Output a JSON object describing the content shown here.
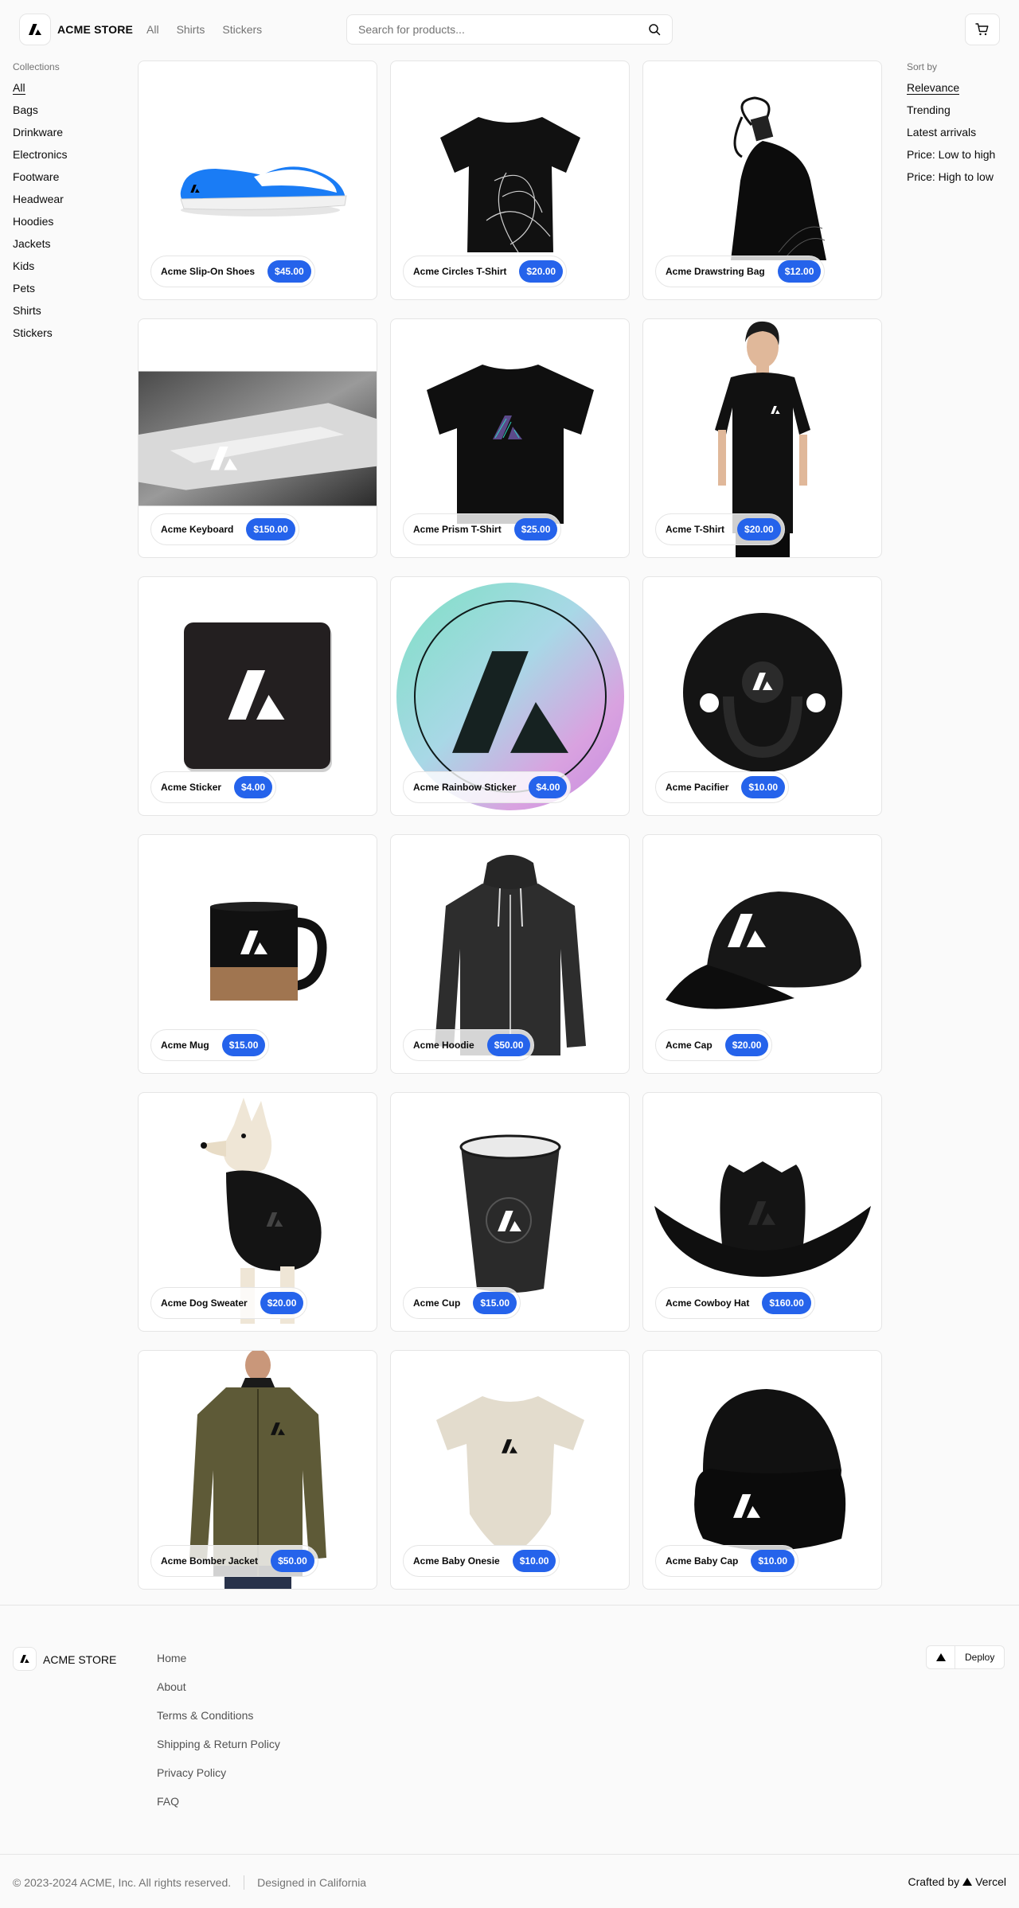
{
  "header": {
    "brand": "ACME STORE",
    "nav": [
      "All",
      "Shirts",
      "Stickers"
    ],
    "search_placeholder": "Search for products..."
  },
  "collections": {
    "title": "Collections",
    "items": [
      "All",
      "Bags",
      "Drinkware",
      "Electronics",
      "Footware",
      "Headwear",
      "Hoodies",
      "Jackets",
      "Kids",
      "Pets",
      "Shirts",
      "Stickers"
    ],
    "active": "All"
  },
  "sort": {
    "title": "Sort by",
    "items": [
      "Relevance",
      "Trending",
      "Latest arrivals",
      "Price: Low to high",
      "Price: High to low"
    ],
    "active": "Relevance"
  },
  "products": [
    {
      "name": "Acme Slip-On Shoes",
      "price": "$45.00"
    },
    {
      "name": "Acme Circles T-Shirt",
      "price": "$20.00"
    },
    {
      "name": "Acme Drawstring Bag",
      "price": "$12.00"
    },
    {
      "name": "Acme Keyboard",
      "price": "$150.00"
    },
    {
      "name": "Acme Prism T-Shirt",
      "price": "$25.00"
    },
    {
      "name": "Acme T-Shirt",
      "price": "$20.00"
    },
    {
      "name": "Acme Sticker",
      "price": "$4.00"
    },
    {
      "name": "Acme Rainbow Sticker",
      "price": "$4.00"
    },
    {
      "name": "Acme Pacifier",
      "price": "$10.00"
    },
    {
      "name": "Acme Mug",
      "price": "$15.00"
    },
    {
      "name": "Acme Hoodie",
      "price": "$50.00"
    },
    {
      "name": "Acme Cap",
      "price": "$20.00"
    },
    {
      "name": "Acme Dog Sweater",
      "price": "$20.00"
    },
    {
      "name": "Acme Cup",
      "price": "$15.00"
    },
    {
      "name": "Acme Cowboy Hat",
      "price": "$160.00"
    },
    {
      "name": "Acme Bomber Jacket",
      "price": "$50.00"
    },
    {
      "name": "Acme Baby Onesie",
      "price": "$10.00"
    },
    {
      "name": "Acme Baby Cap",
      "price": "$10.00"
    }
  ],
  "footer": {
    "brand": "ACME STORE",
    "links": [
      "Home",
      "About",
      "Terms & Conditions",
      "Shipping & Return Policy",
      "Privacy Policy",
      "FAQ"
    ],
    "deploy_label": "Deploy",
    "copyright": "© 2023-2024 ACME, Inc. All rights reserved.",
    "designed": "Designed in California",
    "crafted_prefix": "Crafted by",
    "crafted_brand": "Vercel"
  },
  "icons": {
    "logo": "acme-logo-icon",
    "search": "search-icon",
    "cart": "shopping-cart-icon",
    "deploy": "vercel-triangle-icon"
  },
  "colors": {
    "price_badge": "#2563eb",
    "background": "#fafafa",
    "border": "#e5e5e5"
  }
}
